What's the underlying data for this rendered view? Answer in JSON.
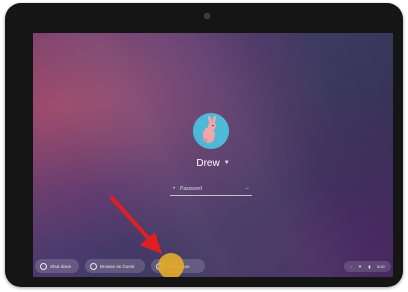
{
  "login": {
    "user_name": "Drew",
    "password_placeholder": "Password"
  },
  "shelf": {
    "shutdown_label": "Shut down",
    "browse_guest_label": "Browse as Guest",
    "add_person_label": "Add Person"
  },
  "status": {
    "time": "5:00"
  },
  "colors": {
    "avatar_bg": "#48b7d6",
    "highlight": "#e2aa28",
    "arrow": "#e02020"
  },
  "icons": {
    "power": "power-icon",
    "guest": "guest-icon",
    "add_person": "add-person-icon",
    "wifi": "wifi-icon",
    "battery": "battery-icon"
  }
}
